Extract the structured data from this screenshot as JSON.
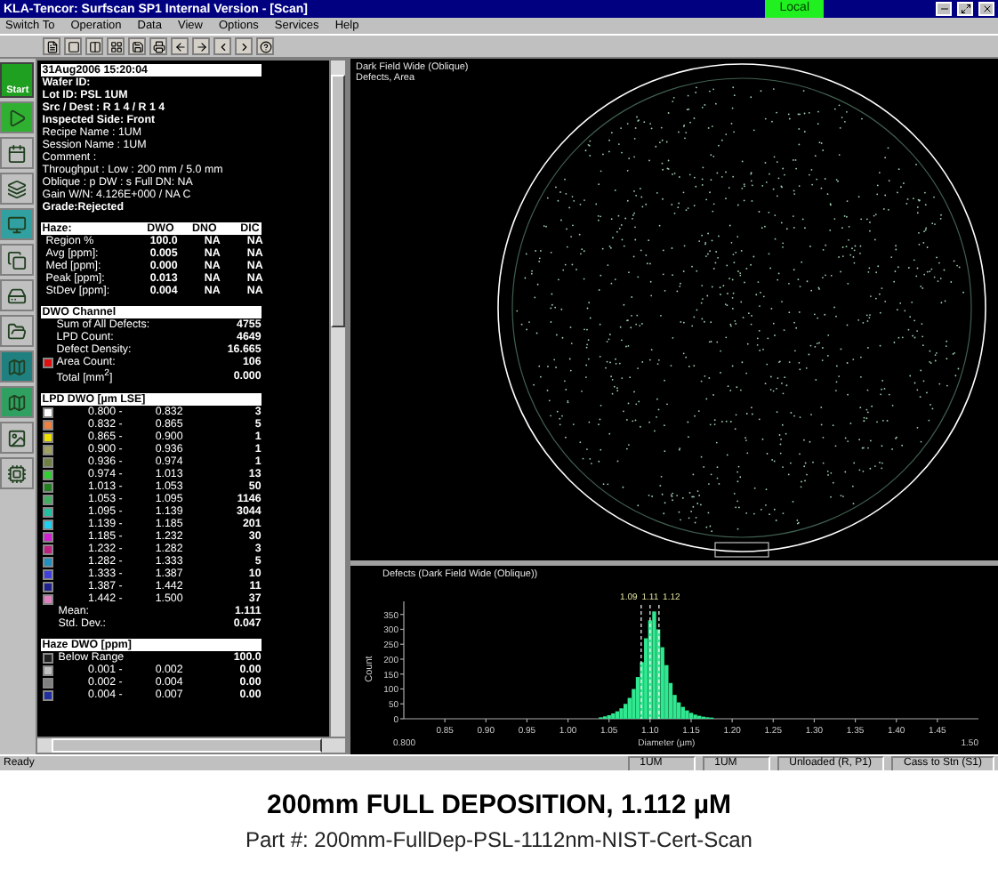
{
  "window": {
    "title": "KLA-Tencor:  Surfscan SP1 Internal Version - [Scan]",
    "badge": "Local"
  },
  "menu": [
    "Switch To",
    "Operation",
    "Data",
    "View",
    "Options",
    "Services",
    "Help"
  ],
  "side_start": "Start",
  "report": {
    "date": "31Aug2006  15:20:04",
    "lines": [
      {
        "text": "Wafer ID:",
        "bold": true
      },
      {
        "text": "Lot ID: PSL 1UM",
        "bold": true
      },
      {
        "text": "Src / Dest :  R 1    4    /    R 1    4",
        "bold": true
      },
      {
        "text": "Inspected Side: Front",
        "bold": true
      },
      {
        "text": "Recipe Name : 1UM",
        "bold": false
      },
      {
        "text": "Session Name : 1UM",
        "bold": false
      },
      {
        "text": "Comment :",
        "bold": false
      },
      {
        "text": "Throughput : Low  : 200 mm / 5.0 mm",
        "bold": false
      },
      {
        "text": "Oblique : p   DW : s   Full   DN: NA",
        "bold": false
      },
      {
        "text": "Gain W/N: 4.126E+000 / NA  C",
        "bold": false
      },
      {
        "text": "Grade:Rejected",
        "bold": true
      }
    ],
    "haze": {
      "columns": [
        "Haze:",
        "DWO",
        "DNO",
        "DIC"
      ],
      "rows": [
        [
          "Region %",
          "100.0",
          "NA",
          "NA"
        ],
        [
          "Avg [ppm]:",
          "0.005",
          "NA",
          "NA"
        ],
        [
          "Med [ppm]:",
          "0.000",
          "NA",
          "NA"
        ],
        [
          "Peak [ppm]:",
          "0.013",
          "NA",
          "NA"
        ],
        [
          "StDev [ppm]:",
          "0.004",
          "NA",
          "NA"
        ]
      ]
    },
    "dwo": {
      "title": "DWO Channel",
      "rows": [
        {
          "label": "Sum of All Defects:",
          "value": "4755"
        },
        {
          "label": "LPD Count:",
          "value": "4649"
        },
        {
          "label": "Defect Density:",
          "value": "16.665"
        },
        {
          "label": "Area Count:",
          "value": "106",
          "color": "#e01010"
        },
        {
          "label": "Total [mm$^{2}$]",
          "value": "0.000"
        }
      ]
    },
    "lpd": {
      "title": "LPD DWO [µm LSE]",
      "bins": [
        {
          "color": "#ffffff",
          "from": "0.800  -",
          "to": "0.832",
          "count": "3"
        },
        {
          "color": "#f08040",
          "from": "0.832  -",
          "to": "0.865",
          "count": "5"
        },
        {
          "color": "#f0e000",
          "from": "0.865  -",
          "to": "0.900",
          "count": "1"
        },
        {
          "color": "#a0a060",
          "from": "0.900  -",
          "to": "0.936",
          "count": "1"
        },
        {
          "color": "#708040",
          "from": "0.936  -",
          "to": "0.974",
          "count": "1"
        },
        {
          "color": "#30d030",
          "from": "0.974  -",
          "to": "1.013",
          "count": "13"
        },
        {
          "color": "#208020",
          "from": "1.013  -",
          "to": "1.053",
          "count": "50"
        },
        {
          "color": "#40b060",
          "from": "1.053  -",
          "to": "1.095",
          "count": "1146"
        },
        {
          "color": "#20c0a0",
          "from": "1.095  -",
          "to": "1.139",
          "count": "3044"
        },
        {
          "color": "#20d0f0",
          "from": "1.139  -",
          "to": "1.185",
          "count": "201"
        },
        {
          "color": "#d020d0",
          "from": "1.185  -",
          "to": "1.232",
          "count": "30"
        },
        {
          "color": "#c02080",
          "from": "1.232  -",
          "to": "1.282",
          "count": "3"
        },
        {
          "color": "#2090c0",
          "from": "1.282  -",
          "to": "1.333",
          "count": "5"
        },
        {
          "color": "#4040e0",
          "from": "1.333  -",
          "to": "1.387",
          "count": "10"
        },
        {
          "color": "#202090",
          "from": "1.387  -",
          "to": "1.442",
          "count": "11"
        },
        {
          "color": "#e080c0",
          "from": "1.442  -",
          "to": "1.500",
          "count": "37"
        }
      ],
      "mean_label": "Mean:",
      "mean": "1.111",
      "std_label": "Std. Dev.:",
      "std": "0.047"
    },
    "haze_dwo": {
      "title": "Haze DWO [ppm]",
      "rows": [
        {
          "color": "#202020",
          "from": "Below Range",
          "to": "",
          "value": "100.0"
        },
        {
          "color": "#c0c0c0",
          "from": "0.001  -",
          "to": "0.002",
          "value": "0.00"
        },
        {
          "color": "#808080",
          "from": "0.002  -",
          "to": "0.004",
          "value": "0.00"
        },
        {
          "color": "#2030a0",
          "from": "0.004  -",
          "to": "0.007",
          "value": "0.00"
        }
      ]
    }
  },
  "map": {
    "title": "Dark Field Wide (Oblique)",
    "subtitle": "Defects, Area"
  },
  "histogram": {
    "title": "Defects (Dark Field Wide (Oblique))",
    "x_min_label": "0.800",
    "x_max_label": "1.50",
    "chart_data": {
      "type": "bar",
      "xlabel": "Diameter (µm)",
      "ylabel": "Count",
      "x": [
        1.04,
        1.045,
        1.05,
        1.055,
        1.06,
        1.065,
        1.07,
        1.075,
        1.08,
        1.085,
        1.09,
        1.095,
        1.1,
        1.105,
        1.11,
        1.115,
        1.12,
        1.125,
        1.13,
        1.135,
        1.14,
        1.145,
        1.15,
        1.155,
        1.16,
        1.165,
        1.17,
        1.175
      ],
      "series": [
        {
          "color": "#30e890",
          "values": [
            5,
            8,
            12,
            18,
            25,
            35,
            50,
            70,
            100,
            140,
            190,
            270,
            330,
            360,
            300,
            240,
            180,
            120,
            80,
            55,
            40,
            28,
            20,
            14,
            10,
            7,
            5,
            4
          ]
        }
      ],
      "xlim": [
        0.8,
        1.5
      ],
      "ylim": [
        0,
        370
      ],
      "xticks": [
        {
          "value": 0.85,
          "label": "0.85"
        },
        {
          "value": 0.9,
          "label": "0.90"
        },
        {
          "value": 0.95,
          "label": "0.95"
        },
        {
          "value": 1.0,
          "label": "1.00"
        },
        {
          "value": 1.05,
          "label": "1.05"
        },
        {
          "value": 1.1,
          "label": "1.10"
        },
        {
          "value": 1.15,
          "label": "1.15"
        },
        {
          "value": 1.2,
          "label": "1.20"
        },
        {
          "value": 1.25,
          "label": "1.25"
        },
        {
          "value": 1.3,
          "label": "1.30"
        },
        {
          "value": 1.35,
          "label": "1.35"
        },
        {
          "value": 1.4,
          "label": "1.40"
        },
        {
          "value": 1.45,
          "label": "1.45"
        }
      ],
      "yticks": [
        0,
        50,
        100,
        150,
        200,
        250,
        300,
        350
      ]
    },
    "markers": [
      {
        "label": "1.09"
      },
      {
        "label": "1.11"
      },
      {
        "label": "1.12"
      }
    ]
  },
  "status_bar": {
    "left": "Ready",
    "fields": [
      "1UM",
      "1UM",
      "Unloaded (R, P1)",
      "Cass to Stn (S1)"
    ]
  },
  "caption": {
    "title": "200mm FULL DEPOSITION, 1.112 µM",
    "subtitle": "Part #: 200mm-FullDep-PSL-1112nm-NIST-Cert-Scan"
  }
}
